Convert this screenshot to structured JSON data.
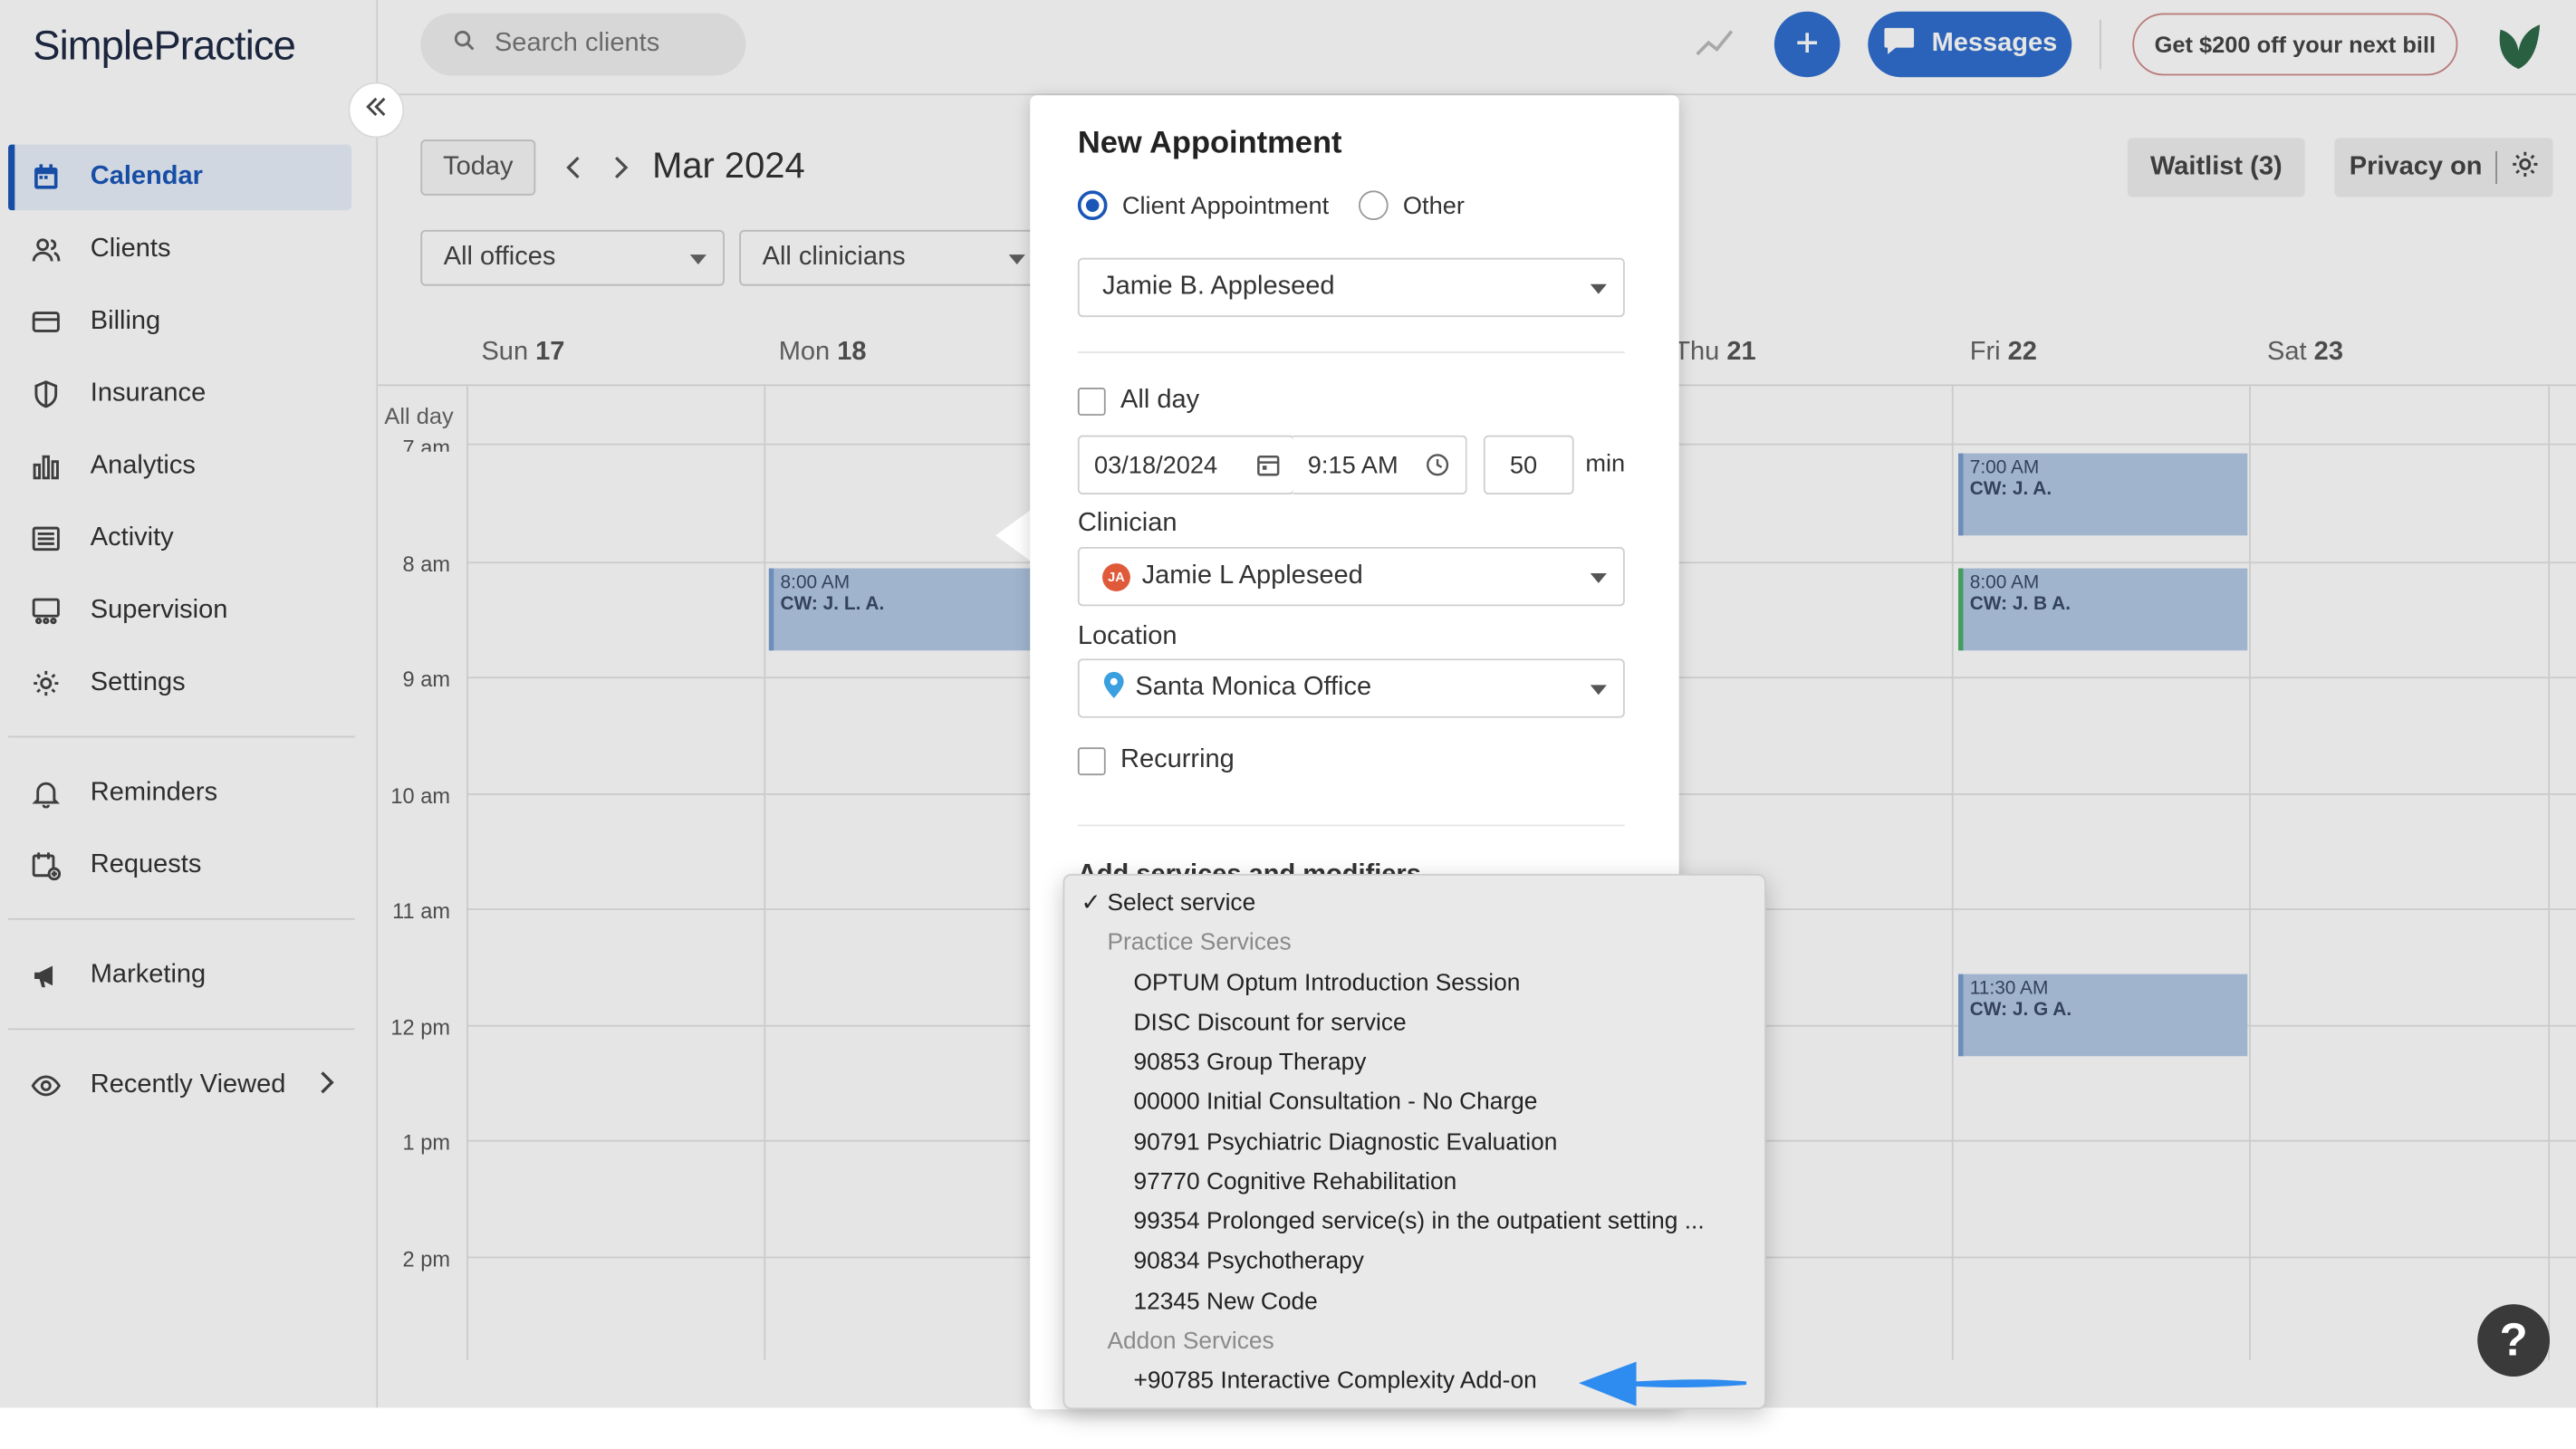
{
  "app": {
    "logo_text": "SimplePractice"
  },
  "sidebar": {
    "items": [
      {
        "label": "Calendar",
        "icon": "calendar-icon",
        "active": true
      },
      {
        "label": "Clients",
        "icon": "users-icon"
      },
      {
        "label": "Billing",
        "icon": "credit-card-icon"
      },
      {
        "label": "Insurance",
        "icon": "shield-icon"
      },
      {
        "label": "Analytics",
        "icon": "bar-chart-icon"
      },
      {
        "label": "Activity",
        "icon": "list-icon"
      },
      {
        "label": "Supervision",
        "icon": "supervision-icon"
      },
      {
        "label": "Settings",
        "icon": "gear-icon"
      }
    ],
    "items2": [
      {
        "label": "Reminders",
        "icon": "bell-icon"
      },
      {
        "label": "Requests",
        "icon": "calendar-plus-icon"
      }
    ],
    "items3": [
      {
        "label": "Marketing",
        "icon": "megaphone-icon"
      }
    ],
    "recently_viewed": "Recently Viewed"
  },
  "topbar": {
    "search_placeholder": "Search clients",
    "messages_label": "Messages",
    "promo_label": "Get $200 off your next bill",
    "accent": "#2f6fce"
  },
  "toolbar": {
    "today_label": "Today",
    "month_label": "Mar 2024",
    "waitlist_label": "Waitlist (3)",
    "privacy_label": "Privacy on",
    "offices_select": "All offices",
    "clinicians_select": "All clinicians"
  },
  "calendar": {
    "days": [
      {
        "name": "Sun",
        "num": "17"
      },
      {
        "name": "Mon",
        "num": "18"
      },
      {
        "name": "Thu",
        "num": "21"
      },
      {
        "name": "Fri",
        "num": "22"
      },
      {
        "name": "Sat",
        "num": "23"
      }
    ],
    "allday_label": "All day",
    "time_labels": [
      "7 am",
      "8 am",
      "9 am",
      "10 am",
      "11 am",
      "12 pm",
      "1 pm",
      "2 pm"
    ],
    "events": [
      {
        "time": "8:00 AM",
        "name": "CW: J. L. A."
      },
      {
        "time": "7:00 AM",
        "name": "CW: J. A."
      },
      {
        "time": "8:00 AM",
        "name": "CW: J. B A."
      },
      {
        "time": "11:30 AM",
        "name": "CW: J. G A."
      }
    ]
  },
  "appointment": {
    "title": "New Appointment",
    "type_client": "Client Appointment",
    "type_other": "Other",
    "client": "Jamie B. Appleseed",
    "all_day_label": "All day",
    "date": "03/18/2024",
    "time": "9:15 AM",
    "duration": "50",
    "duration_unit": "min",
    "clinician_label": "Clinician",
    "clinician_initials": "JA",
    "clinician": "Jamie L Appleseed",
    "location_label": "Location",
    "location": "Santa Monica Office",
    "recurring_label": "Recurring",
    "services_heading": "Add services and modifiers"
  },
  "service_dropdown": {
    "selected": "Select service",
    "group1": "Practice Services",
    "options1": [
      "OPTUM Optum Introduction Session",
      "DISC Discount for service",
      "90853 Group Therapy",
      "00000 Initial Consultation - No Charge",
      "90791 Psychiatric Diagnostic Evaluation",
      "97770 Cognitive Rehabilitation",
      "99354 Prolonged service(s) in the outpatient setting ...",
      "90834 Psychotherapy",
      "12345 New Code"
    ],
    "group2": "Addon Services",
    "options2": [
      "+90785 Interactive Complexity Add-on"
    ]
  },
  "help_label": "?"
}
